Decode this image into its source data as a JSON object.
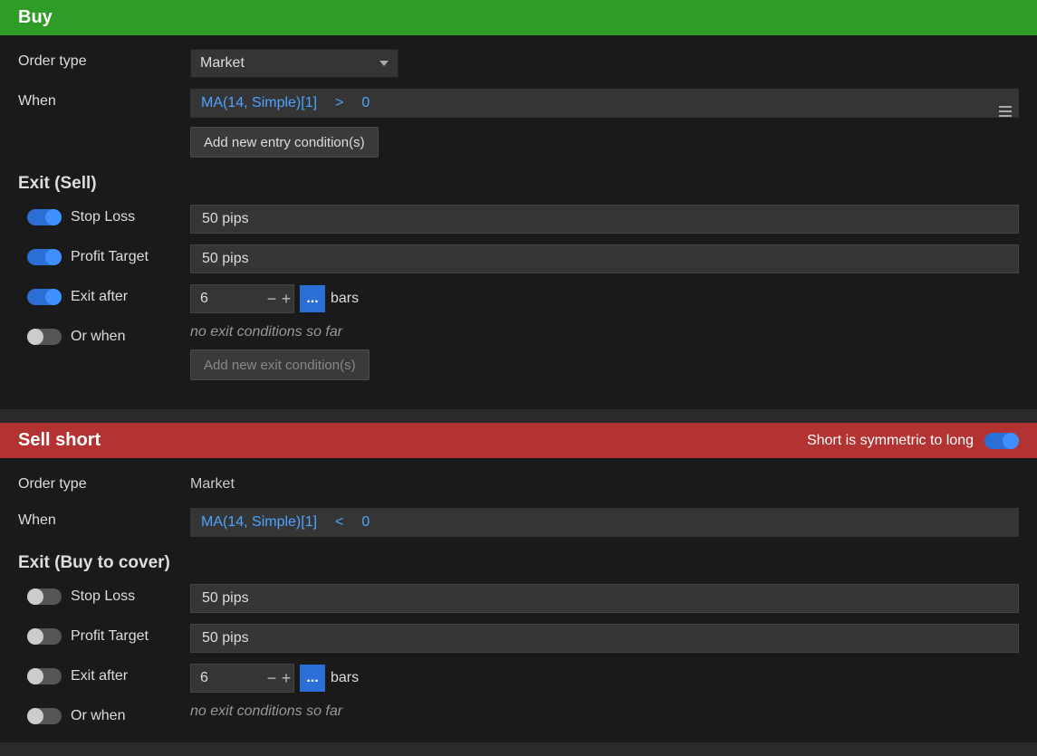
{
  "buy": {
    "title": "Buy",
    "order_type_label": "Order type",
    "order_type_value": "Market",
    "when_label": "When",
    "condition": {
      "left": "MA(14, Simple)[1]",
      "op": ">",
      "right": "0"
    },
    "add_entry_btn": "Add new entry condition(s)",
    "exit_title": "Exit (Sell)",
    "stop_loss_label": "Stop Loss",
    "stop_loss_value": "50 pips",
    "profit_target_label": "Profit Target",
    "profit_target_value": "50 pips",
    "exit_after_label": "Exit after",
    "exit_after_value": "6",
    "exit_after_unit": "bars",
    "dots": "...",
    "or_when_label": "Or when",
    "no_exit_text": "no exit conditions so far",
    "add_exit_btn": "Add new exit condition(s)"
  },
  "sell": {
    "title": "Sell short",
    "symmetric_label": "Short is symmetric to long",
    "order_type_label": "Order type",
    "order_type_value": "Market",
    "when_label": "When",
    "condition": {
      "left": "MA(14, Simple)[1]",
      "op": "<",
      "right": "0"
    },
    "exit_title": "Exit (Buy to cover)",
    "stop_loss_label": "Stop Loss",
    "stop_loss_value": "50 pips",
    "profit_target_label": "Profit Target",
    "profit_target_value": "50 pips",
    "exit_after_label": "Exit after",
    "exit_after_value": "6",
    "exit_after_unit": "bars",
    "dots": "...",
    "or_when_label": "Or when",
    "no_exit_text": "no exit conditions so far"
  }
}
